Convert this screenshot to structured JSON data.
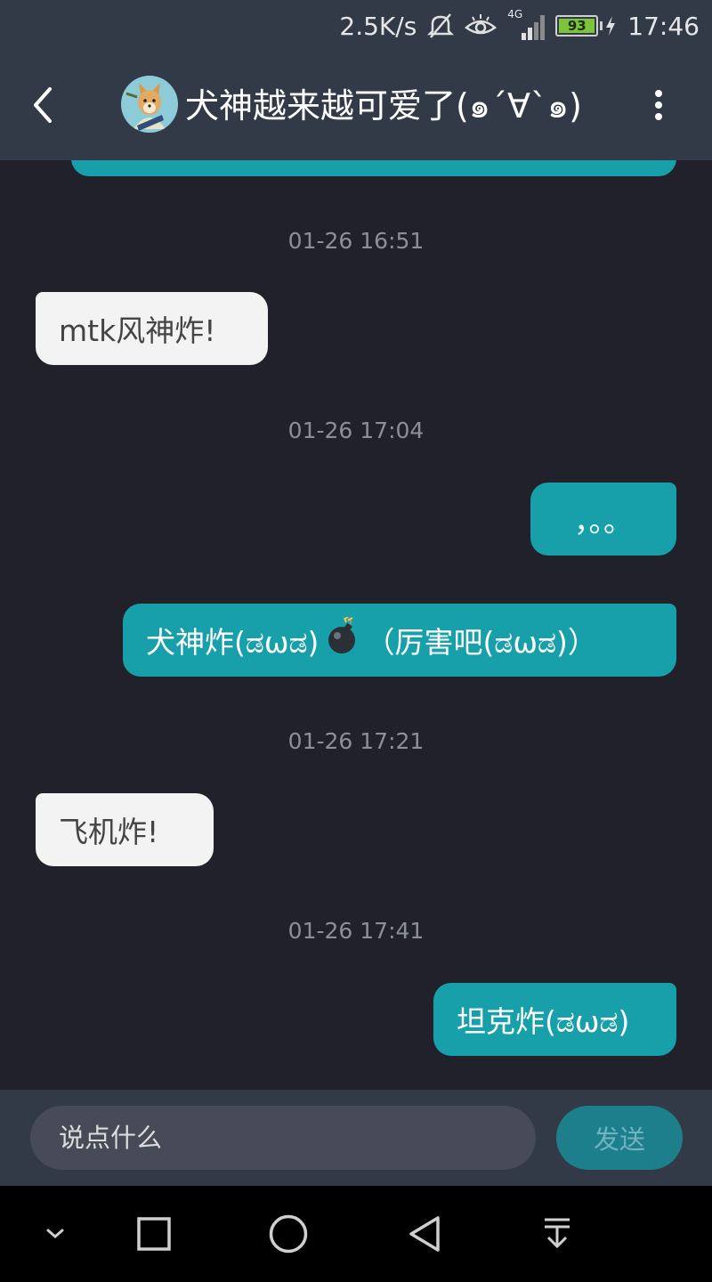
{
  "status_bar": {
    "net_speed": "2.5K/s",
    "network": "4G",
    "battery": "93",
    "time": "17:46",
    "icons": [
      "mute-icon",
      "eye-icon",
      "signal-icon",
      "battery-icon",
      "charging-icon"
    ]
  },
  "header": {
    "title": "犬神越来越可爱了(๑´∀`๑)",
    "icons": [
      "back-arrow-icon",
      "avatar",
      "more-vert-icon"
    ]
  },
  "messages": [
    {
      "time": "01-26 16:51",
      "side": "in",
      "text": "mtk风神炸!"
    },
    {
      "time": "01-26 17:04",
      "side": "out",
      "text": "，。。"
    },
    {
      "side": "out",
      "text_before": "犬神炸(ಡωಡ)",
      "emoji": "bomb-icon",
      "text_after": "（厉害吧(ಡωಡ)）"
    },
    {
      "time": "01-26 17:21",
      "side": "in",
      "text": "飞机炸!"
    },
    {
      "time": "01-26 17:41",
      "side": "out",
      "text": "坦克炸(ಡωಡ)"
    }
  ],
  "composer": {
    "placeholder": "说点什么",
    "send_label": "发送"
  },
  "nav_bar": {
    "icons": [
      "chevron-down-icon",
      "square-icon",
      "circle-icon",
      "back-triangle-icon",
      "download-icon"
    ]
  },
  "colors": {
    "background": "#21212b",
    "bar": "#333a47",
    "outgoing_bubble": "#17a0aa",
    "incoming_bubble": "#f3f3f3",
    "send_button": "#1d7f8c"
  }
}
